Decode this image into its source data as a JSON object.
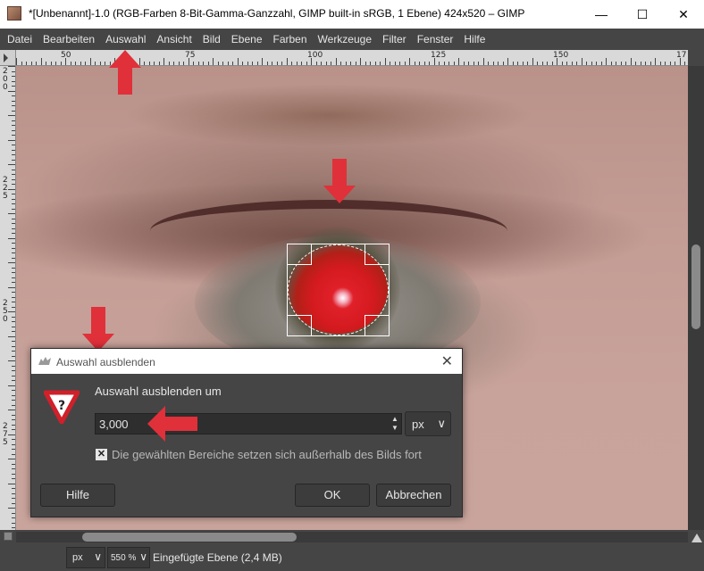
{
  "window": {
    "title": "*[Unbenannt]-1.0 (RGB-Farben 8-Bit-Gamma-Ganzzahl, GIMP built-in sRGB, 1 Ebene) 424x520 – GIMP",
    "minimize": "—",
    "maximize": "☐",
    "close": "✕"
  },
  "menubar": {
    "items": [
      {
        "label": "Datei"
      },
      {
        "label": "Bearbeiten"
      },
      {
        "label": "Auswahl"
      },
      {
        "label": "Ansicht"
      },
      {
        "label": "Bild"
      },
      {
        "label": "Ebene"
      },
      {
        "label": "Farben"
      },
      {
        "label": "Werkzeuge"
      },
      {
        "label": "Filter"
      },
      {
        "label": "Fenster"
      },
      {
        "label": "Hilfe"
      }
    ]
  },
  "ruler_h": {
    "labels": [
      "50",
      "75",
      "100",
      "125",
      "150",
      "17"
    ]
  },
  "ruler_v": {
    "labels": [
      "200",
      "225",
      "250",
      "275"
    ]
  },
  "dialog": {
    "title": "Auswahl ausblenden",
    "close": "✕",
    "heading": "Auswahl ausblenden um",
    "value": "3,000",
    "unit": "px",
    "unit_chevron": "∨",
    "checkbox_mark": "✕",
    "checkbox_label": "Die gewählten Bereiche setzen sich außerhalb des Bilds fort",
    "checkbox_checked": true,
    "buttons": {
      "help": "Hilfe",
      "ok": "OK",
      "cancel": "Abbrechen"
    }
  },
  "statusbar": {
    "unit": "px",
    "zoom": "550 %",
    "chevron": "∨",
    "layer_info": "Eingefügte Ebene (2,4 MB)"
  },
  "colors": {
    "arrow": "#e0303a",
    "ui_dark": "#454545",
    "warn_red": "#d0202a"
  },
  "icons": [
    "app-icon",
    "minimize-icon",
    "maximize-icon",
    "close-icon",
    "warning-icon",
    "chevron-down-icon",
    "spin-arrows-icon",
    "navigate-icon"
  ]
}
